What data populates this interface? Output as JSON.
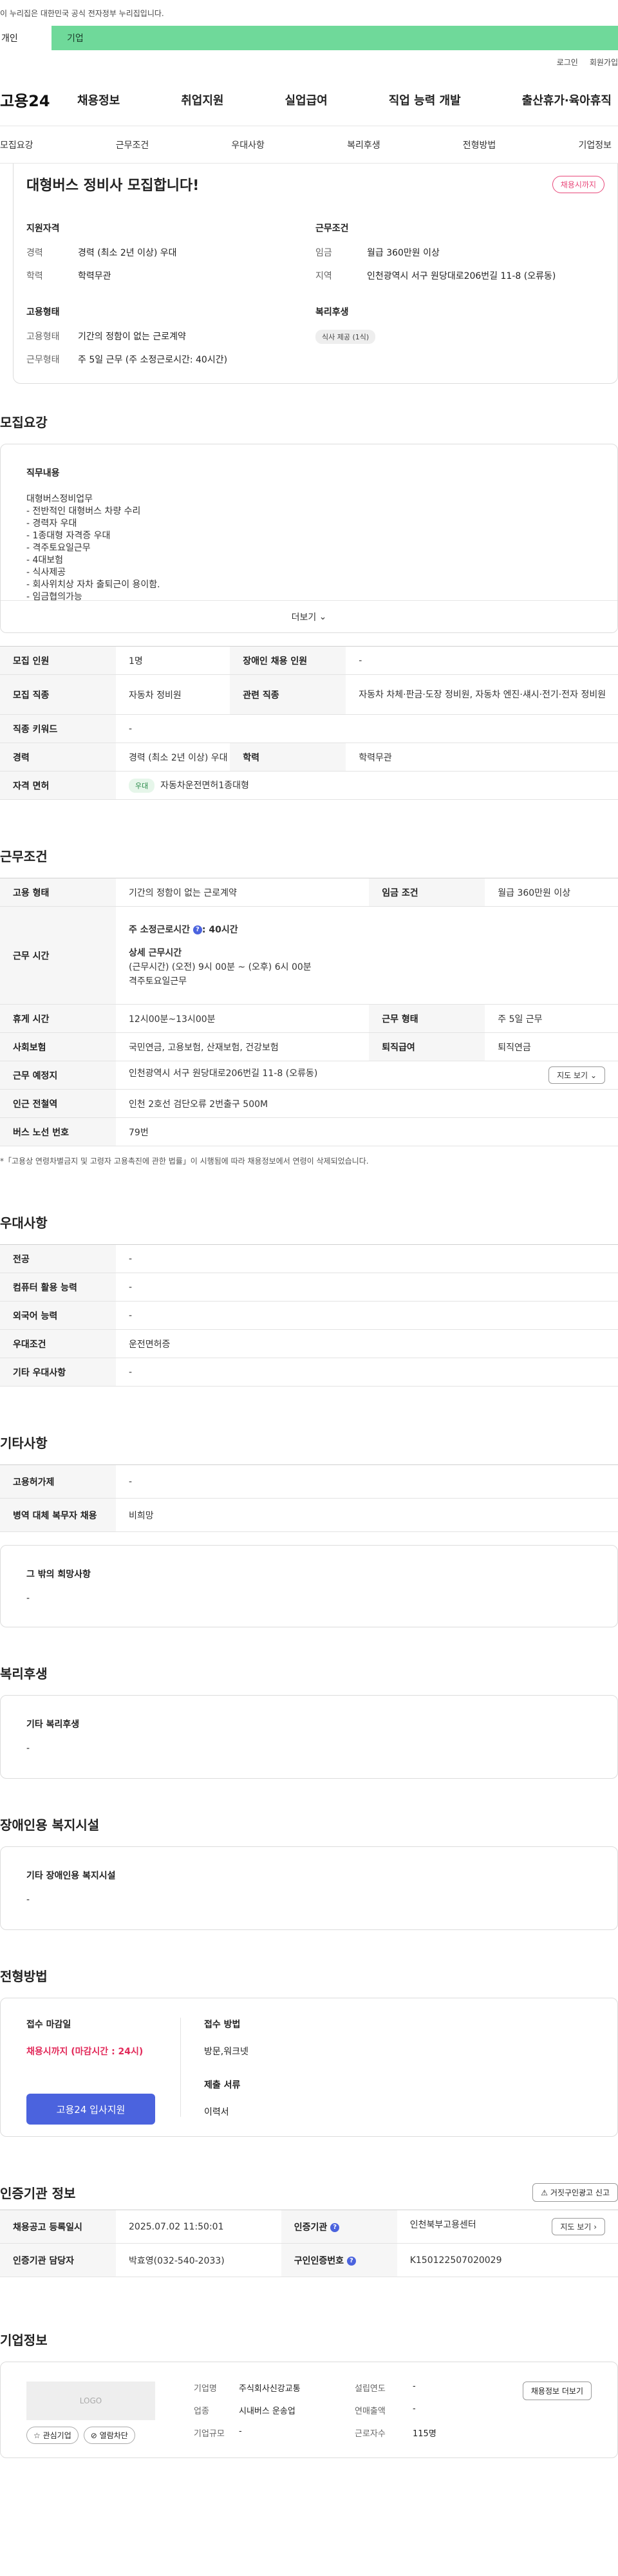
{
  "gov_notice": "이 누리집은 대한민국 공식 전자정부 누리집입니다.",
  "top_tabs": [
    "개인",
    "기업"
  ],
  "util": [
    "로그인",
    "회원가입"
  ],
  "logo": "고용24",
  "gnb": [
    "채용정보",
    "취업지원",
    "실업급여",
    "직업 능력 개발",
    "출산휴가·육아휴직"
  ],
  "subnav": [
    "모집요강",
    "근무조건",
    "우대사항",
    "복리후생",
    "전형방법",
    "기업정보"
  ],
  "summary": {
    "title": "대형버스 정비사 모집합니다!",
    "badge": "채용시까지",
    "qual_title": "지원자격",
    "career_k": "경력",
    "career_v": "경력 (최소 2년 이상) 우대",
    "edu_k": "학력",
    "edu_v": "학력무관",
    "emp_title": "고용형태",
    "emptype_k": "고용형태",
    "emptype_v": "기간의 정함이 없는 근로계약",
    "worktype_k": "근무형태",
    "worktype_v": "주 5일 근무 (주 소정근로시간: 40시간)",
    "cond_title": "근무조건",
    "wage_k": "임금",
    "wage_v": "월급 360만원 이상",
    "area_k": "지역",
    "area_v": "인천광역시 서구 원당대로206번길 11-8 (오류동)",
    "welfare_title": "복리후생",
    "welfare_chip": "식사 제공 (1식)"
  },
  "recruit": {
    "title": "모집요강",
    "duty_title": "직무내용",
    "duty_lines": [
      "대형버스정비업무",
      "- 전반적인 대형버스 차량 수리",
      "- 경력자 우대",
      "- 1종대형 자격증 우대",
      "- 격주토요일근무",
      "- 4대보험",
      "- 식사제공",
      "- 회사위치상 자차 출퇴근이 용이함.",
      "- 임금협의가능"
    ],
    "more": "더보기",
    "rows": {
      "count_k": "모집 인원",
      "count_v": "1명",
      "disabled_k": "장애인 채용 인원",
      "disabled_v": "-",
      "job_k": "모집 직종",
      "job_v": "자동차 정비원",
      "related_k": "관련 직종",
      "related_v": "자동차 차체·판금·도장 정비원, 자동차 엔진·섀시·전기·전자 정비원",
      "keyword_k": "직종 키워드",
      "keyword_v": "-",
      "career_k": "경력",
      "career_v": "경력 (최소 2년 이상) 우대",
      "edu_k": "학력",
      "edu_v": "학력무관",
      "license_k": "자격 면허",
      "license_chip": "우대",
      "license_v": "자동차운전면허1종대형"
    }
  },
  "work": {
    "title": "근무조건",
    "emptype_k": "고용 형태",
    "emptype_v": "기간의 정함이 없는 근로계약",
    "wage_k": "임금 조건",
    "wage_v": "월급 360만원 이상",
    "hours_k": "근무 시간",
    "hours_week": "주 소정근로시간",
    "hours_week_v": ": 40시간",
    "hours_detail_title": "상세 근무시간",
    "hours_detail": "(근무시간) (오전) 9시 00분 ~ (오후) 6시 00분",
    "hours_sat": "격주토요일근무",
    "break_k": "휴게 시간",
    "break_v": "12시00분~13시00분",
    "shift_k": "근무 형태",
    "shift_v": "주 5일 근무",
    "ins_k": "사회보험",
    "ins_v": "국민연금, 고용보험, 산재보험, 건강보험",
    "retire_k": "퇴직급여",
    "retire_v": "퇴직연금",
    "place_k": "근무 예정지",
    "place_v": "인천광역시 서구 원당대로206번길 11-8 (오류동)",
    "map_btn": "지도 보기",
    "subway_k": "인근 전철역",
    "subway_v": "인천 2호선 검단오류 2번출구 500M",
    "bus_k": "버스 노선 번호",
    "bus_v": "79번",
    "note": "*「고용상 연령차별금지 및 고령자 고용촉진에 관한 법률」이 시행됨에 따라 채용정보에서 연령이 삭제되었습니다."
  },
  "pref": {
    "title": "우대사항",
    "major_k": "전공",
    "major_v": "-",
    "pc_k": "컴퓨터 활용 능력",
    "pc_v": "-",
    "lang_k": "외국어 능력",
    "lang_v": "-",
    "cond_k": "우대조건",
    "cond_v": "운전면허증",
    "etc_k": "기타 우대사항",
    "etc_v": "-"
  },
  "etc": {
    "title": "기타사항",
    "welfare_k": "고용허가제",
    "welfare_v": "-",
    "military_k": "병역 대체 복무자 채용",
    "military_v": "비희망",
    "wish_title": "그 밖의 희망사항",
    "wish_v": "-"
  },
  "benefit": {
    "title": "복리후생",
    "box_title": "기타 복리후생",
    "box_v": "-"
  },
  "facility": {
    "title": "장애인용 복지시설",
    "box_title": "기타 장애인용 복지시설",
    "box_v": "-"
  },
  "apply": {
    "title": "전형방법",
    "deadline_title": "접수 마감일",
    "deadline_v": "채용시까지 (마감시간 : 24시)",
    "apply_btn": "고용24 입사지원",
    "method_title": "접수 방법",
    "method_v": "방문,워크넷",
    "docs_title": "제출 서류",
    "docs_v": "이력서"
  },
  "org": {
    "title": "인증기관 정보",
    "report_btn": "거짓구인광고 신고",
    "reg_k": "채용공고 등록일시",
    "reg_v": "2025.07.02 11:50:01",
    "agency_k": "인증기관",
    "agency_v": "인천북부고용센터",
    "map_btn": "지도 보기",
    "mgr_k": "인증기관 담당자",
    "mgr_v": "박효영(032-540-2033)",
    "num_k": "구인인증번호",
    "num_v": "K150122507020029"
  },
  "company": {
    "title": "기업정보",
    "logo_text": "LOGO",
    "fav_btn": "관심기업",
    "block_btn": "열람차단",
    "jobs_btn": "채용정보 더보기",
    "name_k": "기업명",
    "name_v": "주식회사신강교통",
    "year_k": "설립연도",
    "year_v": "-",
    "biz_k": "업종",
    "biz_v": "시내버스 운송업",
    "sales_k": "연매출액",
    "sales_v": "-",
    "size_k": "기업규모",
    "size_v": "-",
    "staff_k": "근로자수",
    "staff_v": "115명"
  }
}
